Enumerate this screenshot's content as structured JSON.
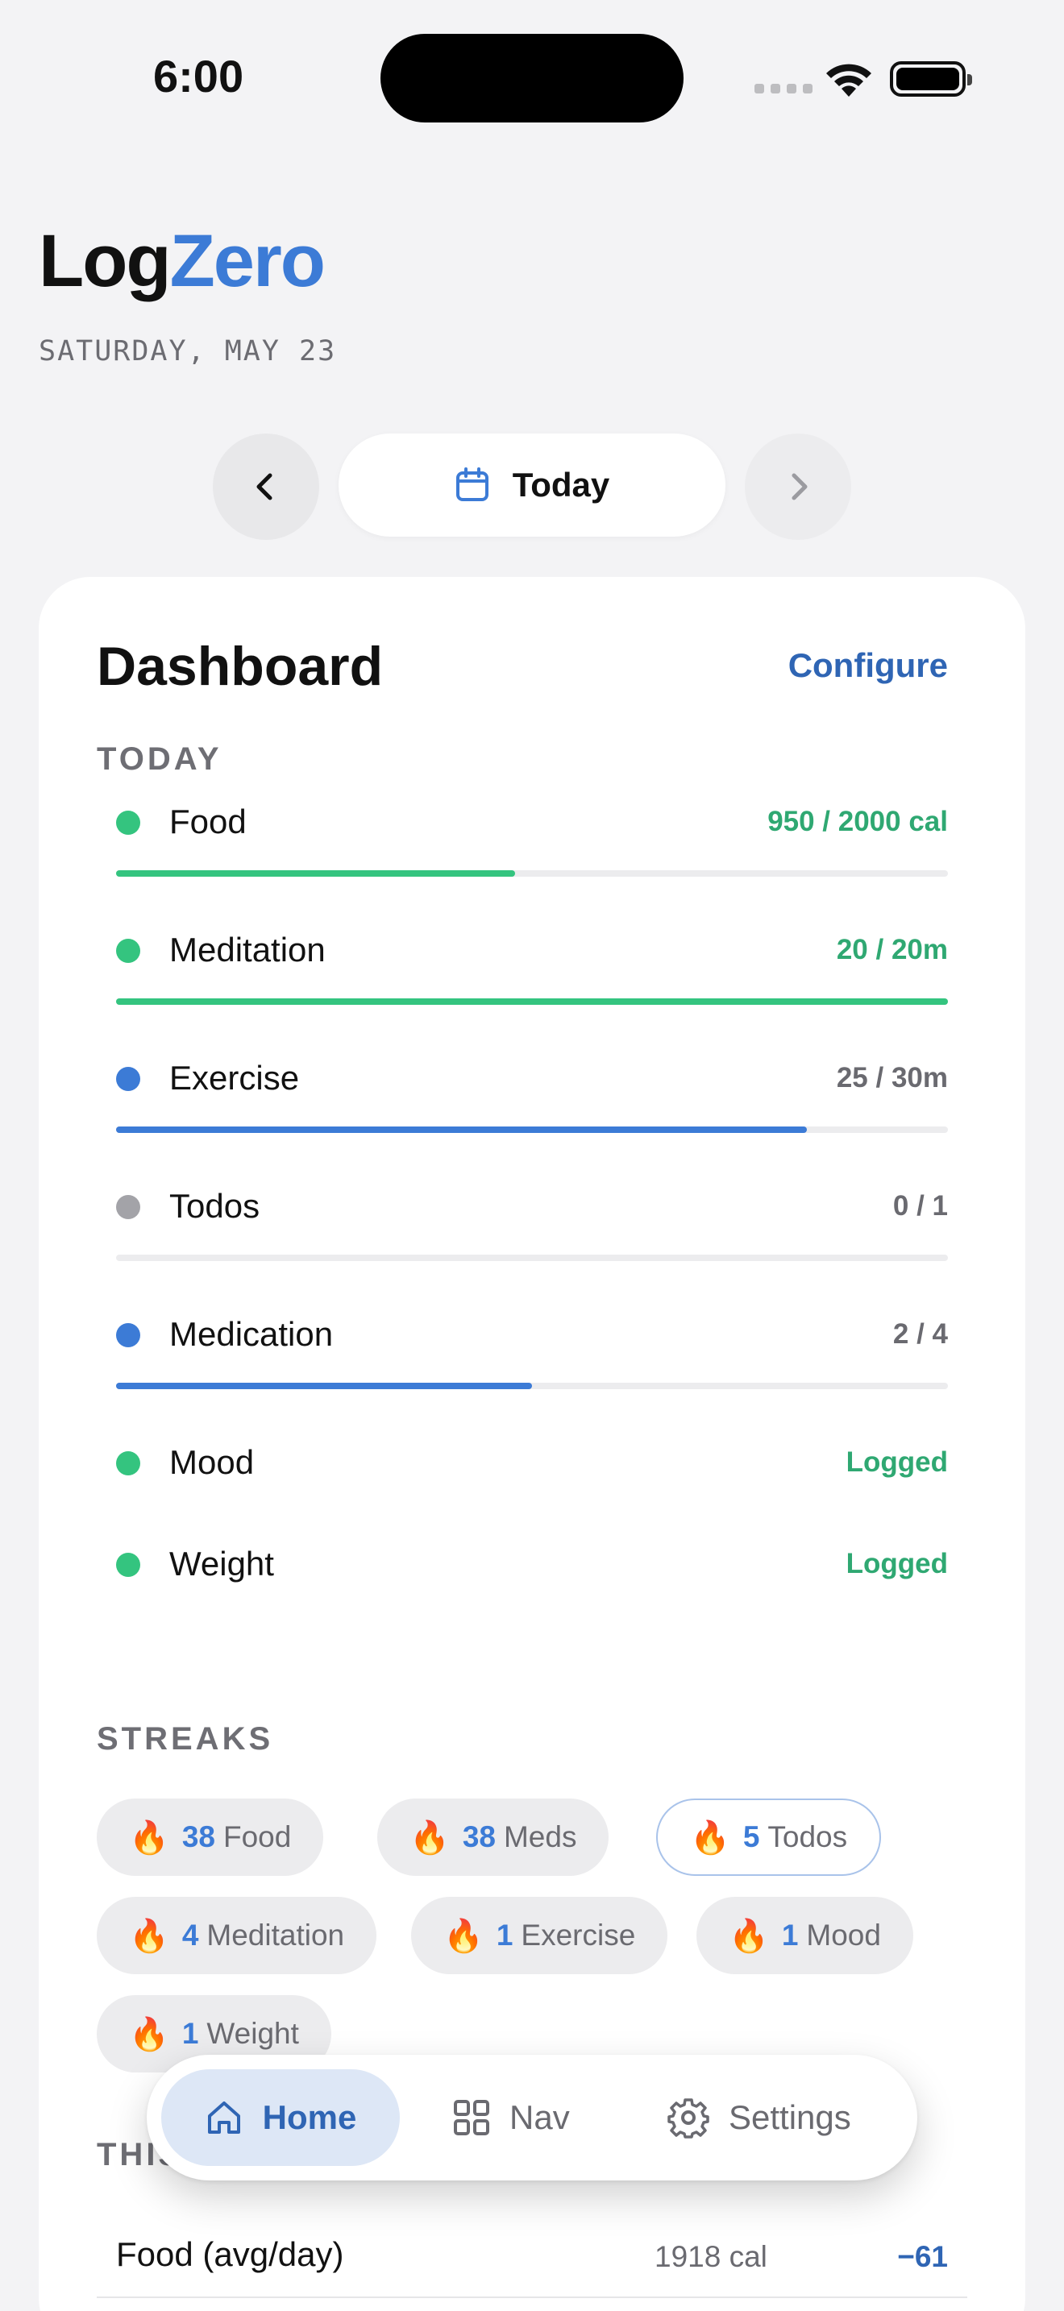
{
  "status_bar": {
    "time": "6:00"
  },
  "header": {
    "brand_part1": "Log",
    "brand_part2": "Zero",
    "date": "SATURDAY, MAY 23"
  },
  "date_nav": {
    "today_label": "Today"
  },
  "dashboard": {
    "title": "Dashboard",
    "configure_label": "Configure",
    "today_label": "TODAY",
    "items": [
      {
        "name": "Food",
        "value": "950 / 2000 cal",
        "progress": 0.48,
        "dot_color": "#34c47f",
        "bar_color": "#34c47f",
        "value_color": "#2fa872"
      },
      {
        "name": "Meditation",
        "value": "20 / 20m",
        "progress": 1.0,
        "dot_color": "#34c47f",
        "bar_color": "#34c47f",
        "value_color": "#2fa872"
      },
      {
        "name": "Exercise",
        "value": "25 / 30m",
        "progress": 0.83,
        "dot_color": "#3c7bd6",
        "bar_color": "#3c7bd6",
        "value_color": "#6a6a70"
      },
      {
        "name": "Todos",
        "value": "0 / 1",
        "progress": 0.0,
        "dot_color": "#a3a3a8",
        "bar_color": "#a3a3a8",
        "value_color": "#6a6a70"
      },
      {
        "name": "Medication",
        "value": "2 / 4",
        "progress": 0.5,
        "dot_color": "#3c7bd6",
        "bar_color": "#3c7bd6",
        "value_color": "#6a6a70"
      },
      {
        "name": "Mood",
        "value": "Logged",
        "dot_color": "#34c47f",
        "value_color": "#2fa872"
      },
      {
        "name": "Weight",
        "value": "Logged",
        "dot_color": "#34c47f",
        "value_color": "#2fa872"
      }
    ],
    "streaks_label": "STREAKS",
    "streaks": [
      {
        "count": "38",
        "label": "Food",
        "highlight": false
      },
      {
        "count": "38",
        "label": "Meds",
        "highlight": false
      },
      {
        "count": "5",
        "label": "Todos",
        "highlight": true
      },
      {
        "count": "4",
        "label": "Meditation",
        "highlight": false
      },
      {
        "count": "1",
        "label": "Exercise",
        "highlight": false
      },
      {
        "count": "1",
        "label": "Mood",
        "highlight": false
      },
      {
        "count": "1",
        "label": "Weight",
        "highlight": false
      }
    ],
    "week_label": "THIS WEEK",
    "week_rows": [
      {
        "label": "Food (avg/day)",
        "value": "1918 cal",
        "delta": "−61"
      }
    ]
  },
  "tabbar": {
    "home": "Home",
    "nav": "Nav",
    "settings": "Settings"
  },
  "colors": {
    "accent": "#3c7bd6",
    "green": "#34c47f",
    "background": "#f3f3f5"
  },
  "icons": {
    "prev": "chevron-left-icon",
    "next": "chevron-right-icon",
    "calendar": "calendar-icon",
    "fire": "fire-icon",
    "home": "home-icon",
    "nav": "grid-icon",
    "settings": "gear-icon"
  }
}
